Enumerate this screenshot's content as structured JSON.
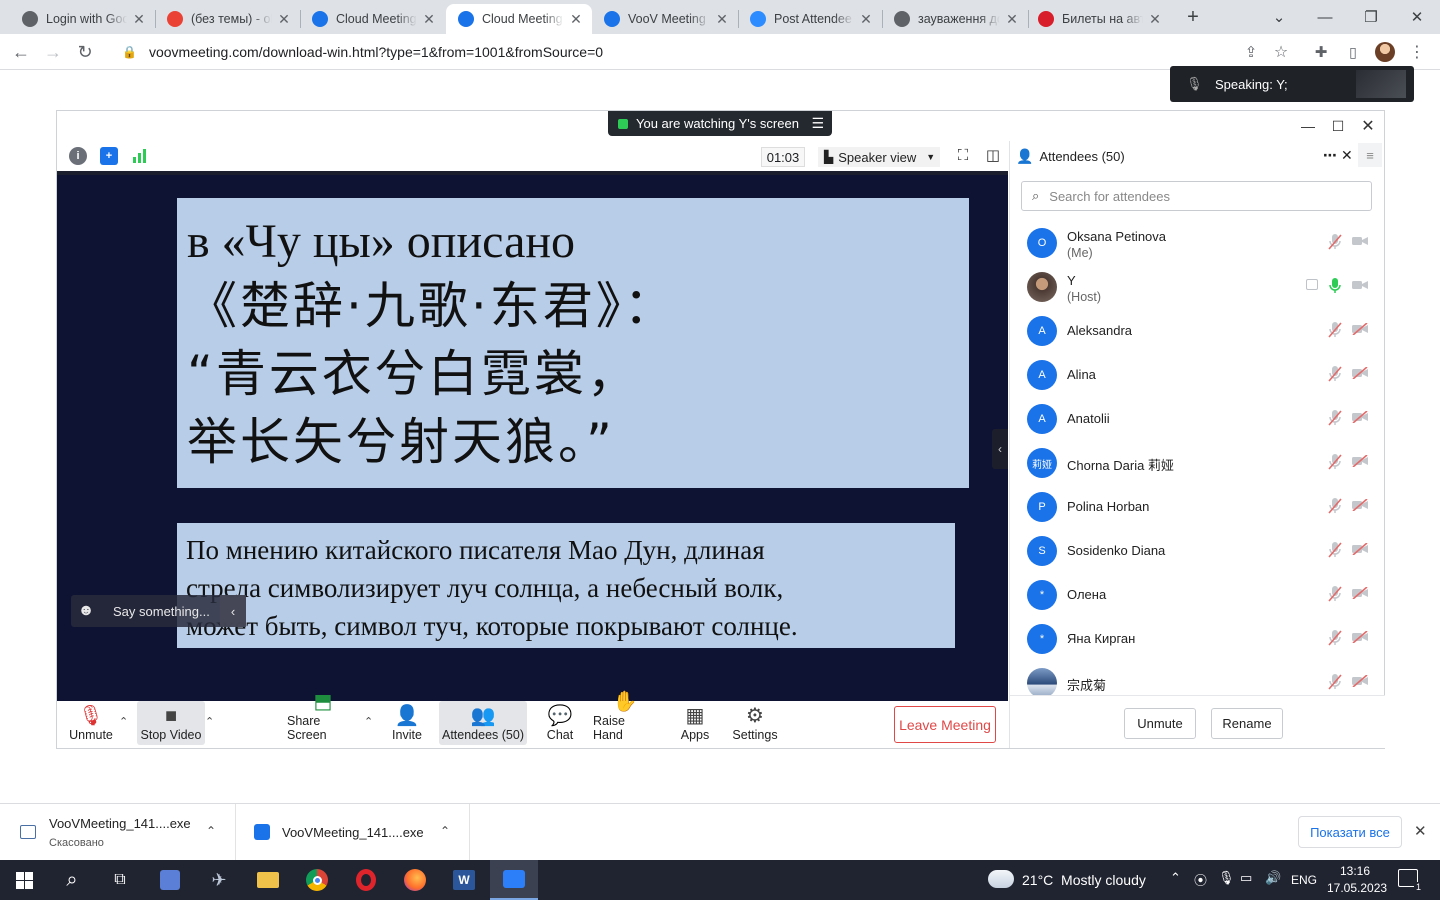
{
  "browser": {
    "tabs": [
      {
        "label": "Login with Goo",
        "favicon": "globe-icon",
        "color": "#5f6368"
      },
      {
        "label": "(без темы) - ok",
        "favicon": "gmail-icon",
        "color": "#ea4335"
      },
      {
        "label": "Cloud Meeting",
        "favicon": "voov-icon",
        "color": "#1a73e8"
      },
      {
        "label": "Cloud Meeting",
        "favicon": "voov-icon",
        "color": "#1a73e8",
        "active": true
      },
      {
        "label": "VooV Meeting",
        "favicon": "voov-icon",
        "color": "#1a73e8"
      },
      {
        "label": "Post Attendee",
        "favicon": "zoom-icon",
        "color": "#2d8cff"
      },
      {
        "label": "зауваження до",
        "favicon": "globe-icon",
        "color": "#5f6368"
      },
      {
        "label": "Билеты на авто",
        "favicon": "bus-icon",
        "color": "#d81e2a"
      }
    ],
    "url": "voovmeeting.com/download-win.html?type=1&from=1001&fromSource=0"
  },
  "meeting": {
    "watching": "You are watching Y's screen",
    "timer": "01:03",
    "view_mode": "Speaker view",
    "slide": {
      "line1": "в «Чу цы» описано",
      "line2": "《楚辞·九歌·东君》：",
      "line3": "“青云衣兮白霓裳，",
      "line4": "举长矢兮射天狼。”",
      "caption_l1": "По мнению китайского писателя Мао Дун, длиная",
      "caption_l2": "стрела символизирует луч солнца, а небесный волк,",
      "caption_l3": "может быть, символ туч, которые покрывают солнце."
    },
    "say_placeholder": "Say something...",
    "toolbar": {
      "unmute": "Unmute",
      "stop_video": "Stop Video",
      "share_screen": "Share Screen",
      "invite": "Invite",
      "attendees": "Attendees (50)",
      "chat": "Chat",
      "raise_hand": "Raise Hand",
      "apps": "Apps",
      "settings": "Settings",
      "leave": "Leave Meeting"
    }
  },
  "attendees_panel": {
    "title": "Attendees (50)",
    "search_placeholder": "Search for attendees",
    "list": [
      {
        "initial": "O",
        "name": "Oksana Petinova",
        "sub": "(Me)",
        "avatar_color": "#1a73e8",
        "mic": "muted",
        "cam": "on"
      },
      {
        "initial": "",
        "name": "Y",
        "sub": "(Host)",
        "avatar_color": "#6b5a52",
        "mic": "active",
        "cam": "on",
        "sharing": true
      },
      {
        "initial": "A",
        "name": "Aleksandra",
        "sub": "",
        "avatar_color": "#1a73e8",
        "mic": "muted",
        "cam": "off"
      },
      {
        "initial": "A",
        "name": "Alina",
        "sub": "",
        "avatar_color": "#1a73e8",
        "mic": "muted",
        "cam": "off"
      },
      {
        "initial": "A",
        "name": "Anatolii",
        "sub": "",
        "avatar_color": "#1a73e8",
        "mic": "muted",
        "cam": "off"
      },
      {
        "initial": "莉娅",
        "name": "Chorna Daria 莉娅",
        "sub": "",
        "avatar_color": "#1a73e8",
        "mic": "muted",
        "cam": "off"
      },
      {
        "initial": "P",
        "name": "Polina Horban",
        "sub": "",
        "avatar_color": "#1a73e8",
        "mic": "muted",
        "cam": "off"
      },
      {
        "initial": "S",
        "name": "Sosidenko Diana",
        "sub": "",
        "avatar_color": "#1a73e8",
        "mic": "muted",
        "cam": "off"
      },
      {
        "initial": "*",
        "name": "Олена",
        "sub": "",
        "avatar_color": "#1a73e8",
        "mic": "muted",
        "cam": "off"
      },
      {
        "initial": "*",
        "name": "Яна Кирган",
        "sub": "",
        "avatar_color": "#1a73e8",
        "mic": "muted",
        "cam": "off"
      },
      {
        "initial": "",
        "name": "宗成菊",
        "sub": "",
        "avatar_color": "#3c5a8a",
        "mic": "muted",
        "cam": "off"
      }
    ],
    "unmute_button": "Unmute",
    "rename_button": "Rename"
  },
  "speaking_toast": "Speaking: Y;",
  "downloads": [
    {
      "file": "VooVMeeting_141....exe",
      "status": "Скасовано"
    },
    {
      "file": "VooVMeeting_141....exe",
      "status": ""
    }
  ],
  "show_all": "Показати все",
  "taskbar": {
    "weather": "21°C  Mostly cloudy",
    "lang": "ENG",
    "time": "13:16",
    "date": "17.05.2023",
    "notif_count": "1"
  }
}
